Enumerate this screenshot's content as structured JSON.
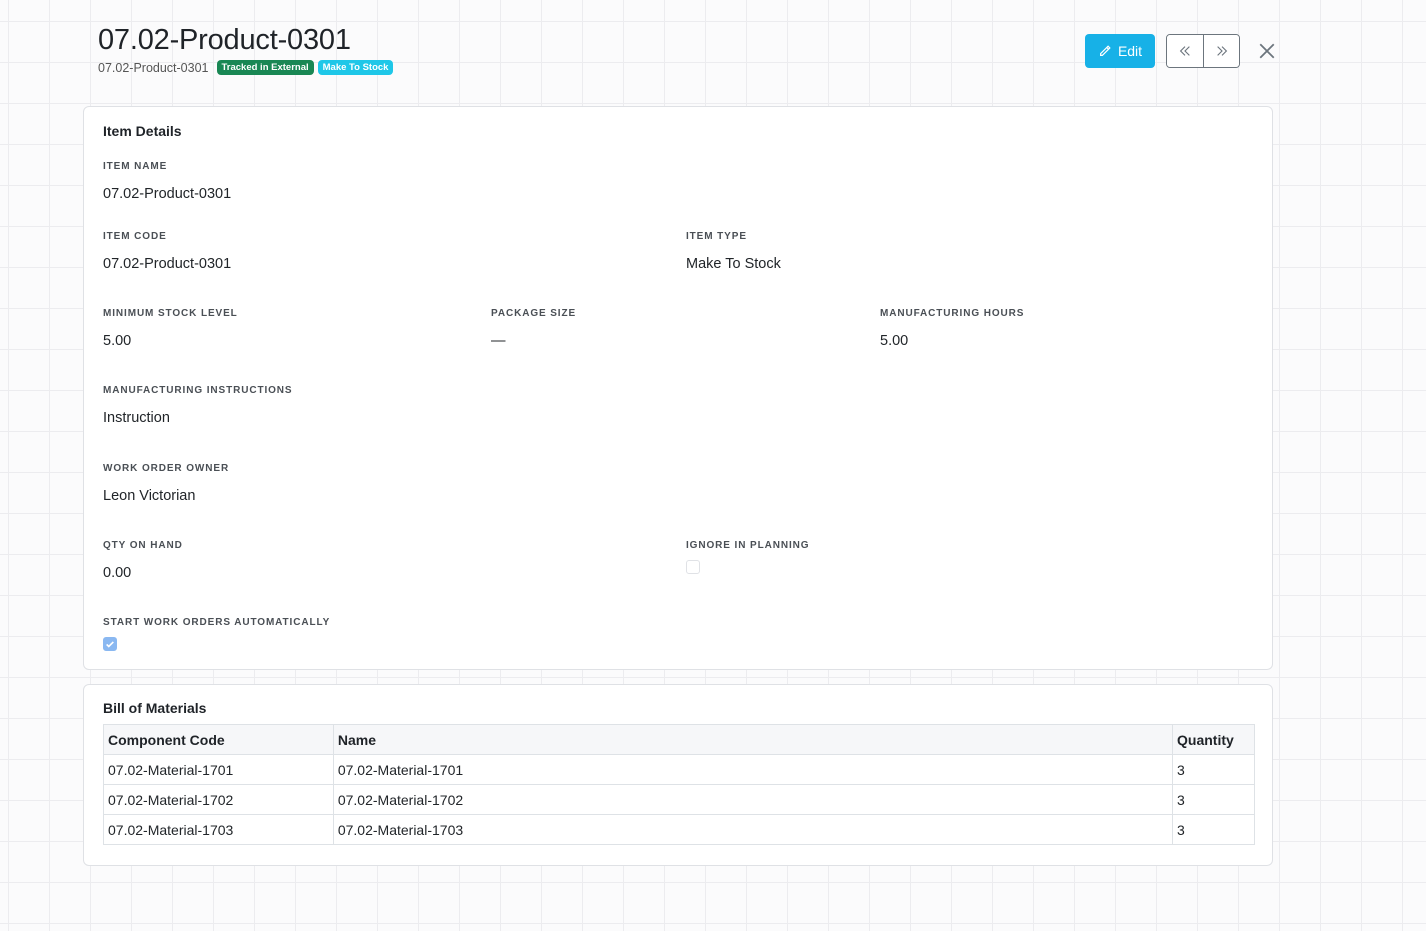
{
  "header": {
    "title": "07.02-Product-0301",
    "subtitle_code": "07.02-Product-0301",
    "badges": [
      {
        "label": "Tracked in External",
        "color": "#198754"
      },
      {
        "label": "Make To Stock",
        "color": "#1ec7e8"
      }
    ],
    "edit_label": "Edit",
    "icons": {
      "edit": "pencil-icon",
      "prev": "double-chevron-left-icon",
      "next": "double-chevron-right-icon",
      "close": "close-icon"
    }
  },
  "details": {
    "title": "Item Details",
    "fields": {
      "item_name": {
        "label": "ITEM NAME",
        "value": "07.02-Product-0301"
      },
      "item_code": {
        "label": "ITEM CODE",
        "value": "07.02-Product-0301"
      },
      "item_type": {
        "label": "ITEM TYPE",
        "value": "Make To Stock"
      },
      "min_stock": {
        "label": "MINIMUM STOCK LEVEL",
        "value": "5.00"
      },
      "package_size": {
        "label": "PACKAGE SIZE",
        "value": "—"
      },
      "mfg_hours": {
        "label": "MANUFACTURING HOURS",
        "value": "5.00"
      },
      "mfg_instructions": {
        "label": "MANUFACTURING INSTRUCTIONS",
        "value": "Instruction"
      },
      "wo_owner": {
        "label": "WORK ORDER OWNER",
        "value": "Leon Victorian"
      },
      "qty_on_hand": {
        "label": "QTY ON HAND",
        "value": "0.00"
      },
      "ignore_planning": {
        "label": "IGNORE IN PLANNING",
        "checked": false
      },
      "start_auto": {
        "label": "START WORK ORDERS AUTOMATICALLY",
        "checked": true
      }
    }
  },
  "bom": {
    "title": "Bill of Materials",
    "columns": [
      "Component Code",
      "Name",
      "Quantity"
    ],
    "rows": [
      [
        "07.02-Material-1701",
        "07.02-Material-1701",
        "3"
      ],
      [
        "07.02-Material-1702",
        "07.02-Material-1702",
        "3"
      ],
      [
        "07.02-Material-1703",
        "07.02-Material-1703",
        "3"
      ]
    ]
  },
  "colors": {
    "accent": "#17b1e7",
    "checkbox_on": "#8ab8f1"
  }
}
